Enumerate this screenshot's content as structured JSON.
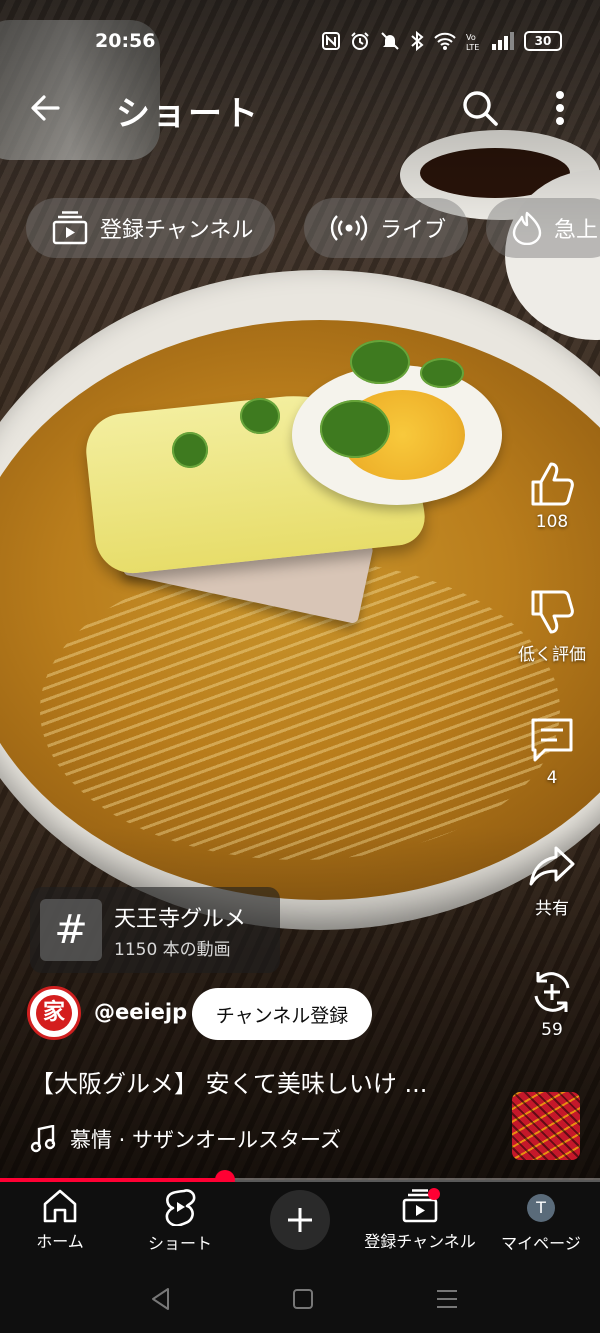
{
  "status_bar": {
    "time": "20:56",
    "battery": "30"
  },
  "header": {
    "title": "ショート"
  },
  "chips": [
    {
      "label": "登録チャンネル",
      "icon": "subscriptions-icon"
    },
    {
      "label": "ライブ",
      "icon": "live-icon"
    },
    {
      "label": "急上",
      "icon": "trending-icon"
    }
  ],
  "actions": {
    "like_count": "108",
    "dislike_label": "低く評価",
    "comment_count": "4",
    "share_label": "共有",
    "remix_count": "59"
  },
  "hashtag": {
    "symbol": "#",
    "name": "天王寺グルメ",
    "video_count": "1150 本の動画"
  },
  "channel": {
    "avatar_text": "家",
    "handle": "@eeiejp",
    "subscribe_label": "チャンネル登録"
  },
  "video": {
    "title": "【大阪グルメ】 安くて美味しいけ ...",
    "music": "慕情 · サザンオールスターズ",
    "progress": 0.375
  },
  "bottom_nav": [
    {
      "label": "ホーム",
      "icon": "home-icon"
    },
    {
      "label": "ショート",
      "icon": "shorts-icon"
    },
    {
      "label": "",
      "icon": "create-icon"
    },
    {
      "label": "登録チャンネル",
      "icon": "subscriptions-icon"
    },
    {
      "label": "マイページ",
      "icon": "profile-avatar",
      "avatar_letter": "T"
    }
  ],
  "colors": {
    "accent": "#ff0033",
    "nav_background": "#0f0f0f"
  }
}
